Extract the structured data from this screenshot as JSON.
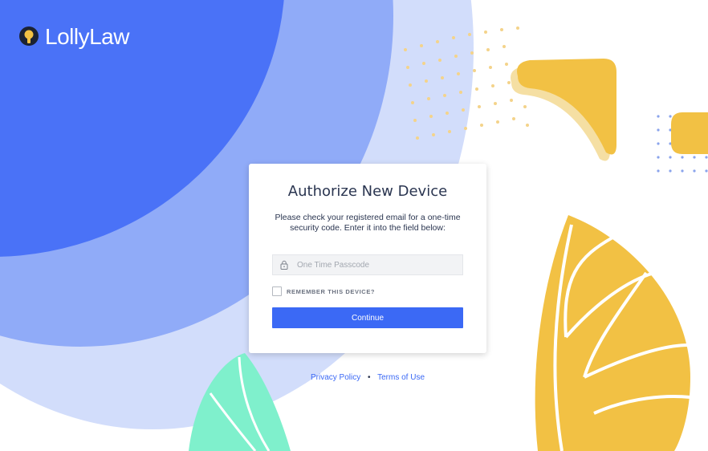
{
  "brand": {
    "name": "LollyLaw",
    "logo_icon": "lollipop-key-icon"
  },
  "card": {
    "title": "Authorize New Device",
    "description": "Please check your registered email for a one-time security code. Enter it into the field below:",
    "passcode": {
      "placeholder": "One Time Passcode",
      "value": "",
      "icon": "lock-icon"
    },
    "remember": {
      "label": "REMEMBER THIS DEVICE?",
      "checked": false
    },
    "continue_label": "Continue"
  },
  "footer": {
    "privacy": "Privacy Policy",
    "separator": "•",
    "terms": "Terms of Use"
  },
  "colors": {
    "primary": "#3b69f5",
    "blob_dark": "#4a72f7",
    "blob_mid": "#8eaaf8",
    "blob_light": "#cfdbfb",
    "accent_yellow": "#f2c144",
    "accent_mint": "#7ff0cc"
  }
}
